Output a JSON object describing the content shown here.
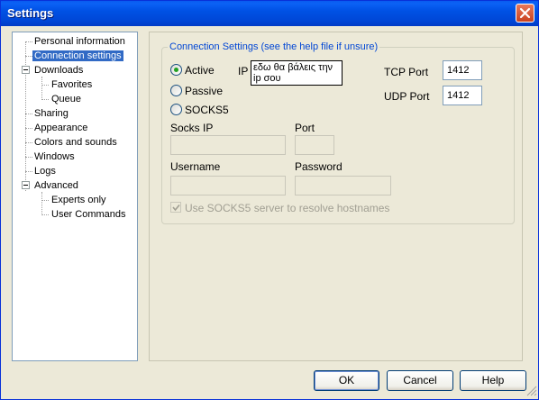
{
  "window": {
    "title": "Settings",
    "close_icon": "close-icon"
  },
  "tree": {
    "items": [
      {
        "label": "Personal information"
      },
      {
        "label": "Connection settings",
        "selected": true
      },
      {
        "label": "Downloads"
      },
      {
        "label": "Favorites"
      },
      {
        "label": "Queue"
      },
      {
        "label": "Sharing"
      },
      {
        "label": "Appearance"
      },
      {
        "label": "Colors and sounds"
      },
      {
        "label": "Windows"
      },
      {
        "label": "Logs"
      },
      {
        "label": "Advanced"
      },
      {
        "label": "Experts only"
      },
      {
        "label": "User Commands"
      }
    ]
  },
  "connection": {
    "group_title": "Connection Settings (see the help file if unsure)",
    "modes": [
      {
        "label": "Active",
        "checked": true
      },
      {
        "label": "Passive",
        "checked": false
      },
      {
        "label": "SOCKS5",
        "checked": false
      }
    ],
    "ip_label": "IP",
    "ip_note": "εδω θα βάλεις την ip σου",
    "tcp_port_label": "TCP Port",
    "tcp_port_value": "1412",
    "udp_port_label": "UDP Port",
    "udp_port_value": "1412",
    "socks_ip_label": "Socks IP",
    "socks_ip_value": "",
    "port_label": "Port",
    "port_value": "",
    "username_label": "Username",
    "username_value": "",
    "password_label": "Password",
    "password_value": "",
    "resolve_label": "Use SOCKS5 server to resolve hostnames",
    "resolve_checked": true
  },
  "buttons": {
    "ok": "OK",
    "cancel": "Cancel",
    "help": "Help"
  },
  "colors": {
    "titlebar": "#0054e3",
    "selection": "#316ac5",
    "group_title": "#0046d5"
  }
}
